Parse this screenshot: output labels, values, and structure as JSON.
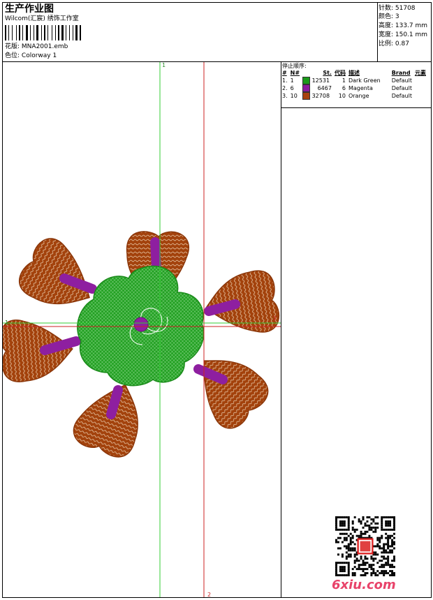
{
  "header": {
    "title": "生产作业图",
    "company": "Wilcom(汇宸) 绣饰工作室",
    "design_label": "花版:",
    "design_value": "MNA2001.emb",
    "colorway_label": "色位:",
    "colorway_value": "Colorway 1"
  },
  "stats": {
    "stitches": "针数: 51708",
    "colors": "颜色: 3",
    "height": "高度: 133.7 mm",
    "width": "宽度: 150.1 mm",
    "scale": "比例: 0.87"
  },
  "stop_sequence": {
    "label": "停止顺序:",
    "columns": [
      "#",
      "N#",
      "St.",
      "代码",
      "描述",
      "Brand",
      "元素"
    ],
    "rows": [
      {
        "idx": "1.",
        "n": "1",
        "st": "12531",
        "code": "1",
        "desc": "Dark Green",
        "brand": "Default",
        "color": "#1a9a1a"
      },
      {
        "idx": "2.",
        "n": "6",
        "st": "6467",
        "code": "6",
        "desc": "Magenta",
        "brand": "Default",
        "color": "#8b1a9e"
      },
      {
        "idx": "3.",
        "n": "10",
        "st": "32708",
        "code": "10",
        "desc": "Orange",
        "brand": "Default",
        "color": "#a8420e"
      }
    ]
  },
  "axes": {
    "v1": "1",
    "v2": "2",
    "h1": "1",
    "h2": "2"
  },
  "colors": {
    "green": "#22a022",
    "magenta": "#8e1fa0",
    "orange": "#a3420c",
    "guide_green": "#33cc33",
    "guide_red": "#cc2222"
  },
  "watermark": "6xiu.com"
}
